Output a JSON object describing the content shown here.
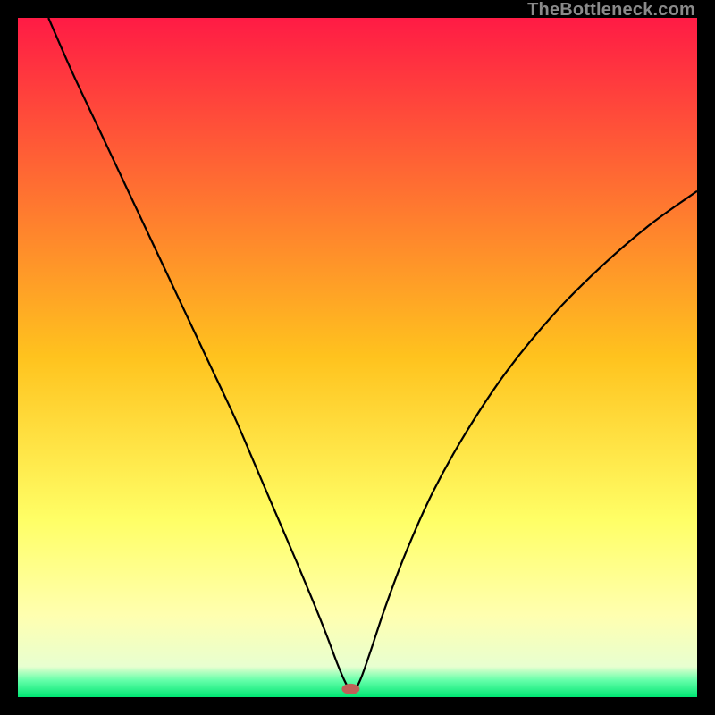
{
  "watermark": "TheBottleneck.com",
  "chart_data": {
    "type": "line",
    "title": "",
    "xlabel": "",
    "ylabel": "",
    "xlim": [
      0,
      100
    ],
    "ylim": [
      0,
      100
    ],
    "background_gradient": {
      "stops": [
        {
          "offset": 0.0,
          "color": "#ff1b45"
        },
        {
          "offset": 0.5,
          "color": "#ffc31e"
        },
        {
          "offset": 0.74,
          "color": "#ffff66"
        },
        {
          "offset": 0.88,
          "color": "#ffffb0"
        },
        {
          "offset": 0.955,
          "color": "#e8ffd0"
        },
        {
          "offset": 0.975,
          "color": "#66ffaa"
        },
        {
          "offset": 1.0,
          "color": "#00e673"
        }
      ]
    },
    "marker": {
      "x": 49,
      "y": 1.2,
      "color": "#c06058",
      "rx": 10,
      "ry": 6
    },
    "series": [
      {
        "name": "curve",
        "color": "#000000",
        "width": 2.2,
        "points": [
          {
            "x": 4.5,
            "y": 100.0
          },
          {
            "x": 8.0,
            "y": 92.0
          },
          {
            "x": 12.0,
            "y": 83.5
          },
          {
            "x": 16.0,
            "y": 75.0
          },
          {
            "x": 20.0,
            "y": 66.5
          },
          {
            "x": 24.0,
            "y": 58.0
          },
          {
            "x": 28.0,
            "y": 49.5
          },
          {
            "x": 32.0,
            "y": 41.0
          },
          {
            "x": 35.0,
            "y": 34.0
          },
          {
            "x": 38.0,
            "y": 27.0
          },
          {
            "x": 41.0,
            "y": 20.0
          },
          {
            "x": 43.5,
            "y": 14.0
          },
          {
            "x": 45.5,
            "y": 9.0
          },
          {
            "x": 47.0,
            "y": 5.0
          },
          {
            "x": 48.2,
            "y": 2.2
          },
          {
            "x": 49.0,
            "y": 1.0
          },
          {
            "x": 49.8,
            "y": 1.4
          },
          {
            "x": 50.6,
            "y": 3.0
          },
          {
            "x": 52.0,
            "y": 7.0
          },
          {
            "x": 54.0,
            "y": 13.0
          },
          {
            "x": 57.0,
            "y": 21.0
          },
          {
            "x": 61.0,
            "y": 30.0
          },
          {
            "x": 66.0,
            "y": 39.0
          },
          {
            "x": 72.0,
            "y": 48.0
          },
          {
            "x": 79.0,
            "y": 56.5
          },
          {
            "x": 86.0,
            "y": 63.5
          },
          {
            "x": 93.0,
            "y": 69.5
          },
          {
            "x": 100.0,
            "y": 74.5
          }
        ]
      }
    ]
  }
}
